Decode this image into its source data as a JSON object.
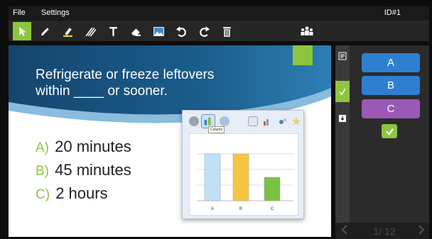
{
  "menu": {
    "file": "File",
    "settings": "Settings",
    "session_id": "ID#1"
  },
  "toolbar": {
    "tools": [
      "select-arrow",
      "pen",
      "highlighter",
      "lines",
      "text",
      "eraser",
      "image",
      "undo",
      "redo",
      "delete"
    ],
    "active_tool": "select-arrow",
    "accent": "#8cc63f"
  },
  "slide": {
    "question_line1": "Refrigerate or freeze leftovers",
    "question_line2": "within ____ or sooner.",
    "answers": [
      {
        "letter": "A)",
        "text": "20 minutes"
      },
      {
        "letter": "B)",
        "text": "45 minutes"
      },
      {
        "letter": "C)",
        "text": "2 hours"
      }
    ]
  },
  "chart_popup": {
    "tooltip": "Column",
    "chart_data": {
      "type": "bar",
      "categories": [
        "A",
        "B",
        "C"
      ],
      "values": [
        4,
        4,
        2
      ],
      "colors": [
        "#bfe0f7",
        "#f5c542",
        "#7bc043"
      ]
    }
  },
  "response_panel": {
    "buttons": [
      {
        "label": "A",
        "color": "#2f7fd1"
      },
      {
        "label": "B",
        "color": "#2f7fd1"
      },
      {
        "label": "C",
        "color": "#9b59b6"
      }
    ],
    "check_color": "#8cc63f"
  },
  "pager": {
    "page": "1/ 12"
  }
}
